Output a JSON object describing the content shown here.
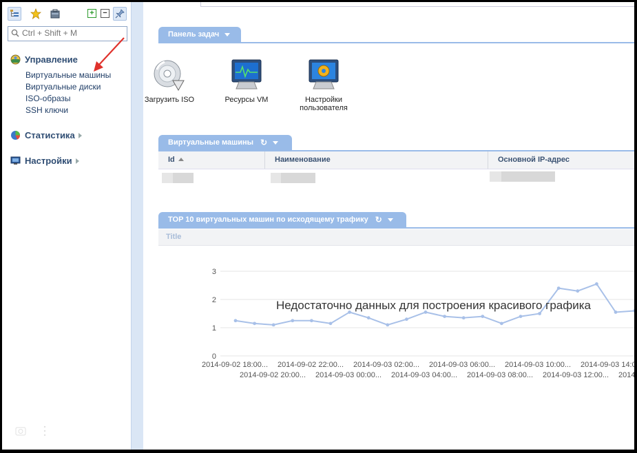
{
  "sidebar": {
    "search_placeholder": "Ctrl + Shift + M",
    "sections": [
      {
        "title": "Управление",
        "items": [
          "Виртуальные машины",
          "Виртуальные диски",
          "ISO-образы",
          "SSH ключи"
        ]
      },
      {
        "title": "Статистика"
      },
      {
        "title": "Настройки"
      }
    ]
  },
  "dashboard": {
    "tab_title": "Панель задач",
    "tiles": [
      {
        "label": "Загрузить ISO",
        "icon": "cd-upload-icon"
      },
      {
        "label": "Ресурсы VM",
        "icon": "monitor-pulse-icon"
      },
      {
        "label": "Настройки пользователя",
        "icon": "monitor-gear-icon"
      }
    ]
  },
  "vms": {
    "tab_title": "Виртуальные машины",
    "columns": [
      "Id",
      "Наименование",
      "Основной IP-адрес"
    ]
  },
  "traffic": {
    "tab_title": "TOP 10 виртуальных машин по исходящему трафику",
    "chart_title_placeholder": "Title",
    "no_data_message": "Недостаточно данных для построения красивого графика"
  },
  "chart_data": {
    "type": "line",
    "title": "Title",
    "ylim": [
      0,
      3
    ],
    "yticks": [
      "0",
      "1",
      "2",
      "3"
    ],
    "x_labels_top": [
      "2014-09-02 18:00...",
      "2014-09-02 22:00...",
      "2014-09-03 02:00...",
      "2014-09-03 06:00...",
      "2014-09-03 10:00...",
      "2014-09-03 14:0"
    ],
    "x_labels_bottom": [
      "2014-09-02 20:00...",
      "2014-09-03 00:00...",
      "2014-09-03 04:00...",
      "2014-09-03 08:00...",
      "2014-09-03 12:00...",
      "2014-"
    ],
    "series": [
      {
        "values": [
          1.25,
          1.15,
          1.1,
          1.25,
          1.25,
          1.15,
          1.55,
          1.35,
          1.1,
          1.3,
          1.55,
          1.4,
          1.35,
          1.4,
          1.15,
          1.4,
          1.5,
          2.4,
          2.3,
          2.55,
          1.55,
          1.6,
          1.65
        ]
      }
    ],
    "grid": true,
    "color": "#a8c0e8"
  }
}
